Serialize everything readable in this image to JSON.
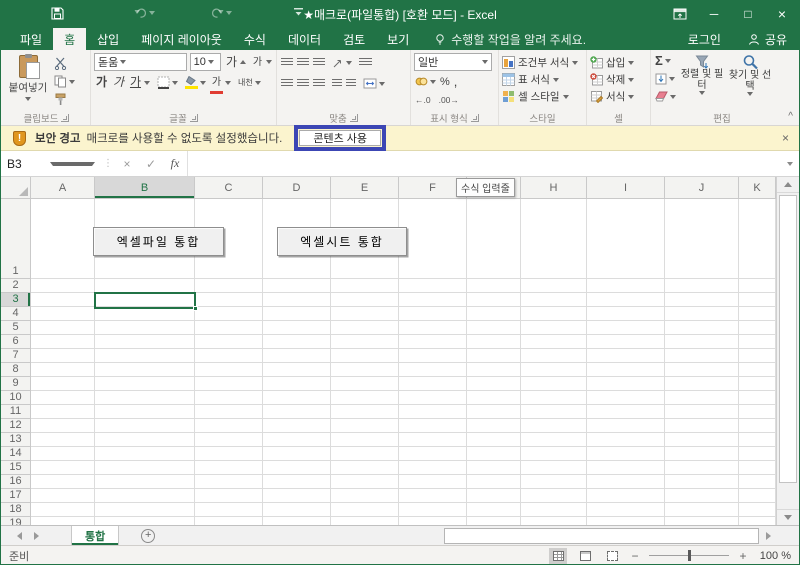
{
  "window": {
    "title": "★매크로(파일통합)  [호환 모드] - Excel"
  },
  "ribbon_tabs": {
    "items": [
      {
        "label": "파일",
        "active": false
      },
      {
        "label": "홈",
        "active": true
      },
      {
        "label": "삽입",
        "active": false
      },
      {
        "label": "페이지 레이아웃",
        "active": false
      },
      {
        "label": "수식",
        "active": false
      },
      {
        "label": "데이터",
        "active": false
      },
      {
        "label": "검토",
        "active": false
      },
      {
        "label": "보기",
        "active": false
      }
    ],
    "tell_me": "수행할 작업을 알려 주세요.",
    "sign_in": "로그인",
    "share": "공유"
  },
  "ribbon": {
    "clipboard": {
      "label": "클립보드",
      "paste": "붙여넣기"
    },
    "font": {
      "label": "글꼴",
      "name": "돋움",
      "size": "10"
    },
    "alignment": {
      "label": "맞춤"
    },
    "number": {
      "label": "표시 형식",
      "format": "일반"
    },
    "styles": {
      "label": "스타일",
      "items": [
        "조건부 서식",
        "표 서식",
        "셀 스타일"
      ]
    },
    "cells": {
      "label": "셀",
      "items": [
        "삽입",
        "삭제",
        "서식"
      ]
    },
    "editing": {
      "label": "편집",
      "sort_filter": "정렬 및 필터",
      "find_select": "찾기 및 선택"
    }
  },
  "warning_bar": {
    "title": "보안 경고",
    "message": "매크로를 사용할 수 없도록 설정했습니다.",
    "action": "콘텐츠 사용"
  },
  "formula_bar": {
    "name_box": "B3",
    "fx": "fx",
    "value": ""
  },
  "grid": {
    "columns": [
      "A",
      "B",
      "C",
      "D",
      "E",
      "F",
      "G",
      "H",
      "I",
      "J",
      "K"
    ],
    "rows": [
      "1",
      "2",
      "3",
      "4",
      "5",
      "6",
      "7",
      "8",
      "9",
      "10",
      "11",
      "12",
      "13",
      "14",
      "15",
      "16",
      "17",
      "18",
      "19"
    ],
    "selected_cell": "B3",
    "selected_column": "B",
    "selected_row": "3",
    "tooltip": "수식 입력줄",
    "form_buttons": [
      {
        "label": "엑셀파일 통합"
      },
      {
        "label": "엑셀시트 통합"
      }
    ]
  },
  "sheet_bar": {
    "tabs": [
      {
        "label": "통합",
        "active": true
      }
    ]
  },
  "status_bar": {
    "mode": "준비",
    "zoom_level": "100 %"
  },
  "icons": {
    "close": "×",
    "minimize": "─",
    "maximize": "□",
    "hangul": "가",
    "phonetic": "내천",
    "percent": "%",
    "comma": ",",
    "increase_decimal": "←.0",
    "decrease_decimal": ".00→",
    "autosum": "Σ",
    "collapse_ribbon": "^",
    "add_sheet": "+",
    "zoom_out": "−",
    "zoom_in": "+",
    "warning_mark": "!",
    "cancel": "×",
    "enter": "✓"
  },
  "colors": {
    "excel_green": "#217346",
    "warning_bg": "#fbf4ce",
    "annotation_blue": "#3c46b4"
  }
}
